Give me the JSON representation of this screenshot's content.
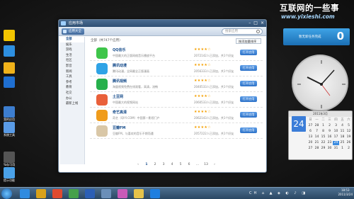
{
  "watermark": {
    "title": "互联网的一些事",
    "url": "www.yixieshi.com"
  },
  "desktop": {
    "icons": [
      {
        "label": "",
        "icon": "spongebob-icon",
        "color": "#f2c500"
      },
      {
        "label": "",
        "icon": "qq-icon",
        "color": "#2d8fe0"
      },
      {
        "label": "",
        "icon": "folder-icon",
        "color": "#f0b21a"
      },
      {
        "label": "",
        "icon": "qq-penguin-icon",
        "color": "#1f6fd1"
      },
      {
        "label": "我的应用",
        "icon": "apps-icon",
        "color": "#3d7ecf"
      },
      {
        "label": "系统工具",
        "icon": "tools-icon",
        "color": "#5a9be6"
      },
      {
        "label": "Ya存可用",
        "icon": "qq-doc-icon",
        "color": "#555"
      },
      {
        "label": "提示功能",
        "icon": "bubble-icon",
        "color": "#4aa1e8"
      }
    ]
  },
  "window": {
    "title": "应用市场",
    "toolbar": {
      "all_apps_label": "应用大全",
      "search_placeholder": "搜索应用"
    },
    "sidebar": [
      "全部",
      "娱乐",
      "游戏",
      "生活",
      "社区",
      "影音",
      "新闻",
      "工具",
      "参考",
      "教育",
      "社交",
      "办公",
      "最新上线"
    ],
    "header": {
      "summary": "全部（共747个应用）",
      "sort_label": "按添加量排序"
    },
    "apps": [
      {
        "name": "QQ音乐",
        "desc": "中国最大的正版网络音乐播放平台",
        "stars": "★★★★☆",
        "count": "2072142人已添加，共1个好友",
        "button": "打开应用",
        "color": "#3ec54a"
      },
      {
        "name": "腾讯动漫",
        "desc": "腾讯动漫，全网最全正版漫画",
        "stars": "★★★★☆",
        "count": "2056333人已添加，共1个好友",
        "button": "打开应用",
        "color": "#2fa3e6"
      },
      {
        "name": "腾讯视频",
        "desc": "海量视频免费在线观看，高清，流畅",
        "stars": "★★★★☆",
        "count": "2040533人已添加，共1个好友",
        "button": "打开应用",
        "color": "#27b04c"
      },
      {
        "name": "土豆网",
        "desc": "中国最大的视频网站",
        "stars": "★★★★☆",
        "count": "2060533人已添加，共1个好友",
        "button": "打开应用",
        "color": "#e9603a"
      },
      {
        "name": "奇艺高清",
        "desc": "奇艺（QIYI.COM）中国第一影视门户",
        "stars": "★★★★☆",
        "count": "2062143人已添加，共1个好友",
        "button": "打开应用",
        "color": "#f09c1c"
      },
      {
        "name": "豆瓣FM",
        "desc": "豆瓣FM，与喜欢的音乐不期而遇",
        "stars": "★★★★☆",
        "count": "2057222人已添加，共1个好友",
        "button": "打开应用",
        "color": "#d9c7a7"
      }
    ],
    "pager": [
      "‹",
      "1",
      "2",
      "3",
      "4",
      "5",
      "6",
      "...",
      "13",
      "›"
    ]
  },
  "gadgets": {
    "banner": {
      "text": "暂无新任务完成",
      "count": "0"
    },
    "calendar": {
      "header": "2011年3月",
      "weekdays": [
        "日",
        "一",
        "二",
        "三",
        "四",
        "五",
        "六"
      ],
      "days": [
        "27",
        "28",
        "1",
        "2",
        "3",
        "4",
        "5",
        "6",
        "7",
        "8",
        "9",
        "10",
        "11",
        "12",
        "13",
        "14",
        "15",
        "16",
        "17",
        "18",
        "19",
        "20",
        "21",
        "22",
        "23",
        "24",
        "25",
        "26",
        "27",
        "28",
        "29",
        "30",
        "31",
        "1",
        "2",
        "3",
        "4",
        "5",
        "6",
        "7",
        "8",
        "9"
      ],
      "big_day": "24",
      "selected": "24"
    }
  },
  "taskbar": {
    "time": "18:53",
    "date": "2011/3/24",
    "apps": [
      {
        "icon": "ie-icon",
        "color": "#2f8be0"
      },
      {
        "icon": "folder-icon",
        "color": "#d9a21a"
      },
      {
        "icon": "chrome-icon",
        "color": "#e04a2f"
      },
      {
        "icon": "grid-icon",
        "color": "#45a04a"
      },
      {
        "icon": "word-icon",
        "color": "#2b5fb5"
      },
      {
        "icon": "store-icon",
        "color": "#6b8fb8"
      },
      {
        "icon": "paint-icon",
        "color": "#c85ab8"
      },
      {
        "icon": "notes-icon",
        "color": "#e6c34a"
      },
      {
        "icon": "qq-icon",
        "color": "#1f7fe0"
      }
    ],
    "tray": "CH ⌂ ▲ ◈ ◐ ♪ ◨"
  }
}
